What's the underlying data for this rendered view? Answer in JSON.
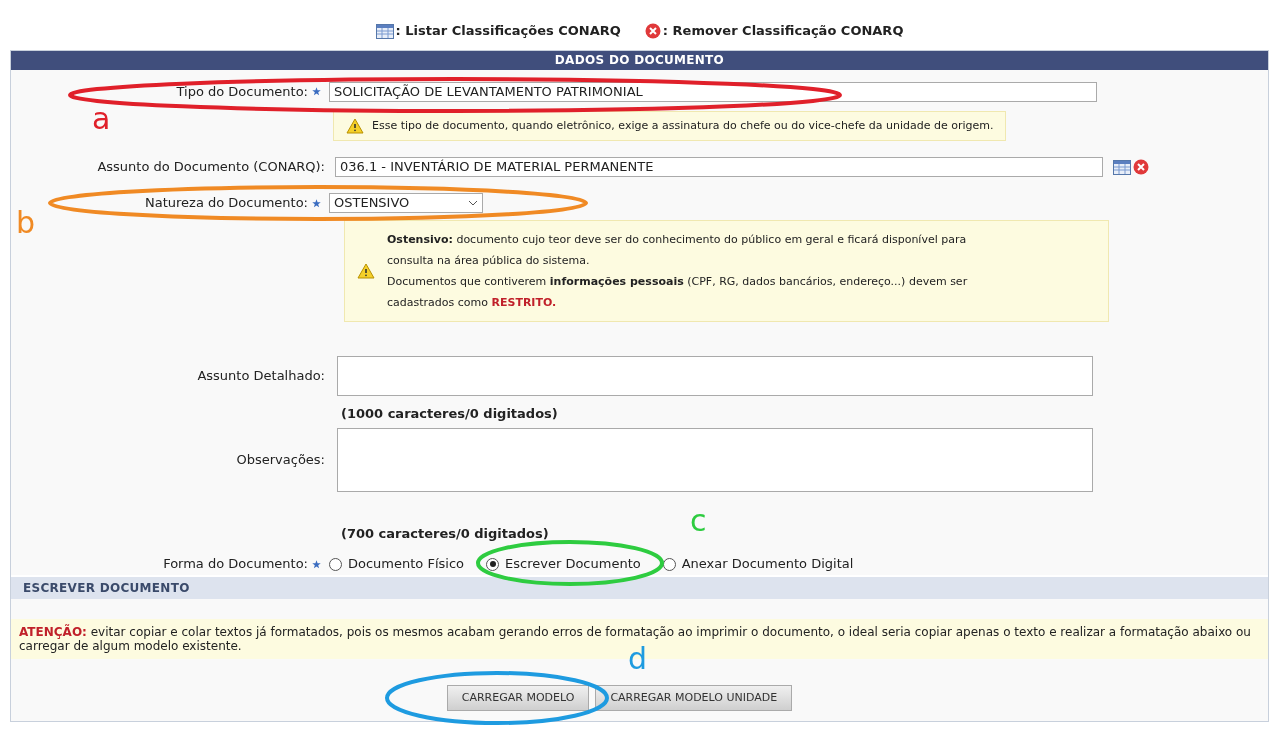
{
  "top_legend": [
    {
      "kind": "list",
      "label": ": Listar Classificações CONARQ"
    },
    {
      "kind": "remove",
      "label": ": Remover Classificação CONARQ"
    }
  ],
  "section_title": "DADOS DO DOCUMENTO",
  "tipo": {
    "label": "Tipo do Documento:",
    "required": true,
    "value": "SOLICITAÇÃO DE LEVANTAMENTO PATRIMONIAL",
    "warning": "Esse tipo de documento, quando eletrônico, exige a assinatura do chefe ou do vice-chefe da unidade de origem."
  },
  "assunto": {
    "label": "Assunto do Documento (CONARQ):",
    "value": "036.1 - INVENTÁRIO DE MATERIAL PERMANENTE"
  },
  "natureza": {
    "label": "Natureza do Documento:",
    "required": true,
    "value": "OSTENSIVO",
    "warning_lines": [
      "**Ostensivo:** documento cujo teor deve ser do conhecimento do público em geral e ficará disponível para",
      "consulta na área pública do sistema.",
      "Documentos que contiverem **informações pessoais** (CPF, RG, dados bancários, endereço...) devem ser",
      "cadastrados como"
    ],
    "warning_emphasis": "RESTRITO."
  },
  "assunto_detalhado": {
    "label": "Assunto Detalhado:",
    "counter": "(1000 caracteres/0 digitados)"
  },
  "observacoes": {
    "label": "Observações:",
    "counter": "(700 caracteres/0 digitados)"
  },
  "forma": {
    "label": "Forma do Documento:",
    "required": true,
    "options": [
      {
        "label": "Documento Físico",
        "selected": false
      },
      {
        "label": "Escrever Documento",
        "selected": true
      },
      {
        "label": "Anexar Documento Digital",
        "selected": false
      }
    ]
  },
  "escrever_title": "ESCREVER DOCUMENTO",
  "atencao": {
    "lead": "ATENÇÃO:",
    "text": "evitar copiar e colar textos já formatados, pois os mesmos acabam gerando erros de formatação ao imprimir o documento, o ideal seria copiar apenas o texto e realizar a formatação abaixo ou carregar de algum modelo existente."
  },
  "buttons": [
    "CARREGAR MODELO",
    "CARREGAR MODELO UNIDADE"
  ],
  "annotations": [
    {
      "letter": "a",
      "color": "#e0202a"
    },
    {
      "letter": "b",
      "color": "#f08a24"
    },
    {
      "letter": "c",
      "color": "#2ecc40"
    },
    {
      "letter": "d",
      "color": "#1e9be0"
    }
  ]
}
